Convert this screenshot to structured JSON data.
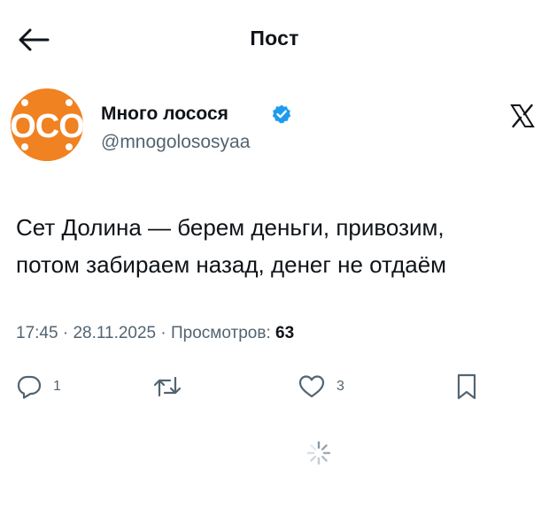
{
  "header": {
    "title": "Пост",
    "back_icon": "arrow-left-icon"
  },
  "author": {
    "name": "Много лосося",
    "handle": "@mnogolososyaa",
    "avatar_text": "OCO",
    "verified_icon": "verified-badge-icon",
    "verified_color": "#1d9bf0",
    "avatar_color": "#f08221"
  },
  "platform_icon": "x-logo-icon",
  "tweet": {
    "lines": [
      "Сет Долина — берем деньги, привозим,",
      "потом забираем назад, денег не отдаём"
    ]
  },
  "meta": {
    "time": "17:45",
    "separator": " · ",
    "date": "28.11.2025",
    "views_label": "Просмотров:",
    "views_count": "63"
  },
  "actions": {
    "reply": {
      "icon": "reply-icon",
      "count": "1"
    },
    "retweet": {
      "icon": "retweet-icon"
    },
    "like": {
      "icon": "heart-icon",
      "count": "3"
    },
    "bookmark": {
      "icon": "bookmark-icon"
    }
  },
  "loading_icon": "loading-spinner-icon"
}
